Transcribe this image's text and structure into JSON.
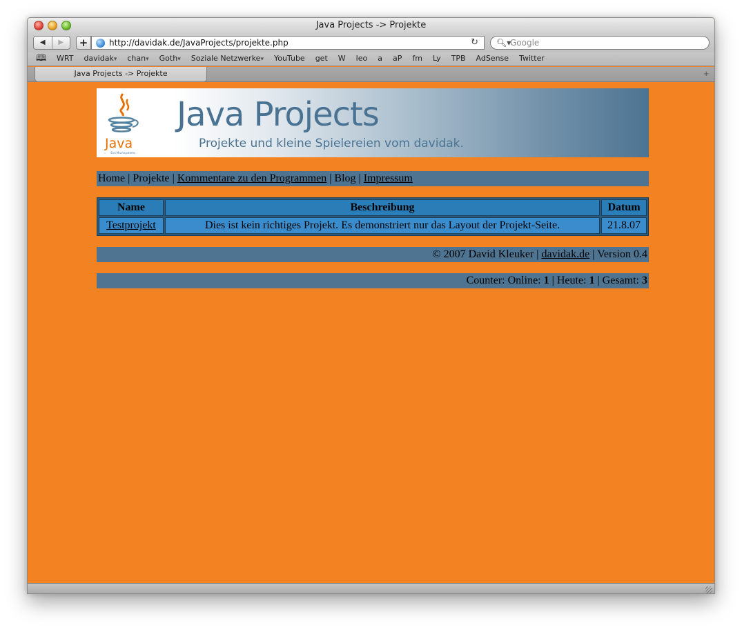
{
  "window": {
    "title": "Java Projects -> Projekte"
  },
  "toolbar": {
    "back_icon": "back-arrow-icon",
    "forward_icon": "forward-arrow-icon",
    "add_label": "+",
    "url": "http://davidak.de/JavaProjects/projekte.php",
    "search_placeholder": "Google"
  },
  "bookmarks": {
    "items": [
      {
        "label": "WRT",
        "menu": false
      },
      {
        "label": "davidak",
        "menu": true
      },
      {
        "label": "chan",
        "menu": true
      },
      {
        "label": "Goth",
        "menu": true
      },
      {
        "label": "Soziale Netzwerke",
        "menu": true
      },
      {
        "label": "YouTube",
        "menu": false
      },
      {
        "label": "get",
        "menu": false
      },
      {
        "label": "W",
        "menu": false
      },
      {
        "label": "leo",
        "menu": false
      },
      {
        "label": "a",
        "menu": false
      },
      {
        "label": "aP",
        "menu": false
      },
      {
        "label": "fm",
        "menu": false
      },
      {
        "label": "Ly",
        "menu": false
      },
      {
        "label": "TPB",
        "menu": false
      },
      {
        "label": "AdSense",
        "menu": false
      },
      {
        "label": "Twitter",
        "menu": false
      }
    ]
  },
  "tabs": [
    {
      "label": "Java Projects -> Projekte"
    }
  ],
  "banner": {
    "logo_word": "Java",
    "logo_small": "Sun Microsystems",
    "title": "Java Projects",
    "subtitle": "Projekte und kleine Spielereien vom davidak."
  },
  "nav": {
    "home": "Home",
    "projekte": "Projekte",
    "kommentare": "Kommentare zu den Programmen",
    "blog": "Blog",
    "impressum": "Impressum",
    "separator": " | "
  },
  "table": {
    "headers": {
      "name": "Name",
      "beschreibung": "Beschreibung",
      "datum": "Datum"
    },
    "rows": [
      {
        "name": "Testprojekt",
        "beschreibung": "Dies ist kein richtiges Projekt. Es demonstriert nur das Layout der Projekt-Seite.",
        "datum": "21.8.07"
      }
    ]
  },
  "footer": {
    "copyright": "© 2007 David Kleuker | ",
    "link": "davidak.de",
    "version": " | Version 0.4"
  },
  "counter": {
    "online_label": "Counter: Online: ",
    "online": "1",
    "heute_label": " | Heute: ",
    "heute": "1",
    "gesamt_label": " | Gesamt: ",
    "gesamt": "3"
  },
  "colors": {
    "page_bg": "#f38222",
    "bar_bg": "#4e7491",
    "table_header": "#2b7db8",
    "table_cell": "#3a8ccc"
  }
}
